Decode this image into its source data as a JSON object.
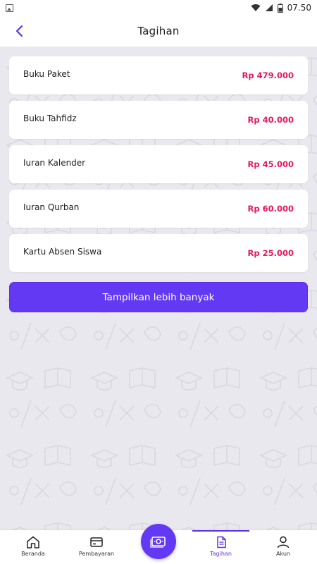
{
  "status_bar": {
    "time": "07.50"
  },
  "header": {
    "title": "Tagihan"
  },
  "bills": [
    {
      "name": "Buku Paket",
      "amount": "Rp 479.000"
    },
    {
      "name": "Buku Tahfidz",
      "amount": "Rp 40.000"
    },
    {
      "name": "Iuran Kalender",
      "amount": "Rp 45.000"
    },
    {
      "name": "Iuran Qurban",
      "amount": "Rp 60.000"
    },
    {
      "name": "Kartu Absen Siswa",
      "amount": "Rp 25.000"
    }
  ],
  "more_button": {
    "label": "Tampilkan lebih banyak"
  },
  "bottom_nav": {
    "items": [
      {
        "label": "Beranda",
        "icon": "home-icon"
      },
      {
        "label": "Pembayaran",
        "icon": "credit-card-icon"
      },
      {
        "label": "",
        "icon": "cash-icon"
      },
      {
        "label": "Tagihan",
        "icon": "document-icon"
      },
      {
        "label": "Akun",
        "icon": "user-icon"
      }
    ],
    "active": "Tagihan"
  },
  "colors": {
    "accent": "#6339f3",
    "amount": "#e5195e",
    "background": "#e9e8ee"
  }
}
